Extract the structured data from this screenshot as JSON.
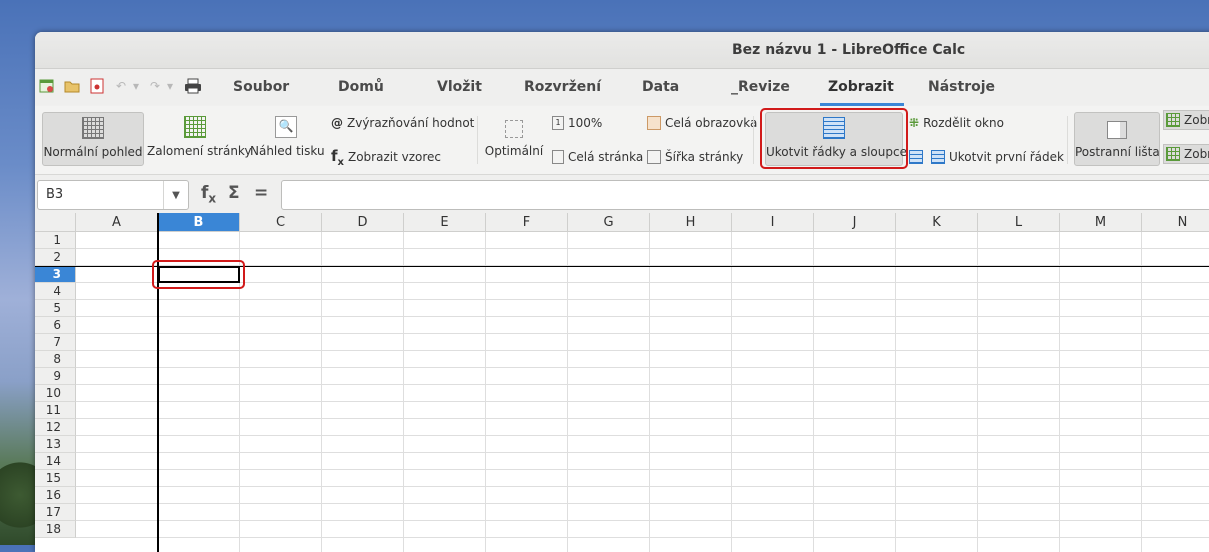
{
  "window": {
    "title": "Bez názvu 1 - LibreOffice Calc"
  },
  "menubar": {
    "items": [
      {
        "id": "soubor",
        "label": "Soubor"
      },
      {
        "id": "domu",
        "label": "Domů"
      },
      {
        "id": "vlozit",
        "label": "Vložit"
      },
      {
        "id": "rozvrzeni",
        "label": "Rozvržení"
      },
      {
        "id": "data",
        "label": "Data"
      },
      {
        "id": "revize",
        "label": "_Revize"
      },
      {
        "id": "zobrazit",
        "label": "Zobrazit",
        "active": true
      },
      {
        "id": "nastroje",
        "label": "Nástroje"
      }
    ]
  },
  "ribbon": {
    "normal_view": "Normální pohled",
    "page_break": "Zalomení stránky",
    "print_preview": "Náhled tisku",
    "value_highlighting": "Zvýrazňování hodnot",
    "show_formula": "Zobrazit vzorec",
    "optimal": "Optimální",
    "zoom_100": "100%",
    "whole_page": "Celá stránka",
    "full_screen": "Celá obrazovka",
    "page_width": "Šířka stránky",
    "freeze_rows_cols": "Ukotvit řádky a sloupce",
    "split_window": "Rozdělit okno",
    "freeze_first_row": "Ukotvit první řádek",
    "sidebar": "Postranní lišta",
    "show_top": "Zobr",
    "show_bottom": "Zobr"
  },
  "formula_bar": {
    "name_box": "B3",
    "fx": "fx",
    "sum": "Σ",
    "equals": "=",
    "content": ""
  },
  "sheet": {
    "columns": [
      "A",
      "B",
      "C",
      "D",
      "E",
      "F",
      "G",
      "H",
      "I",
      "J",
      "K",
      "L",
      "M",
      "N"
    ],
    "rows": [
      "1",
      "2",
      "3",
      "4",
      "5",
      "6",
      "7",
      "8",
      "9",
      "10",
      "11",
      "12",
      "13",
      "14",
      "15",
      "16",
      "17",
      "18"
    ],
    "selected_cell": "B3",
    "selected_column": "B",
    "selected_row": "3"
  },
  "highlight_color": "#d11a1a",
  "selection_color": "#3a86d6"
}
